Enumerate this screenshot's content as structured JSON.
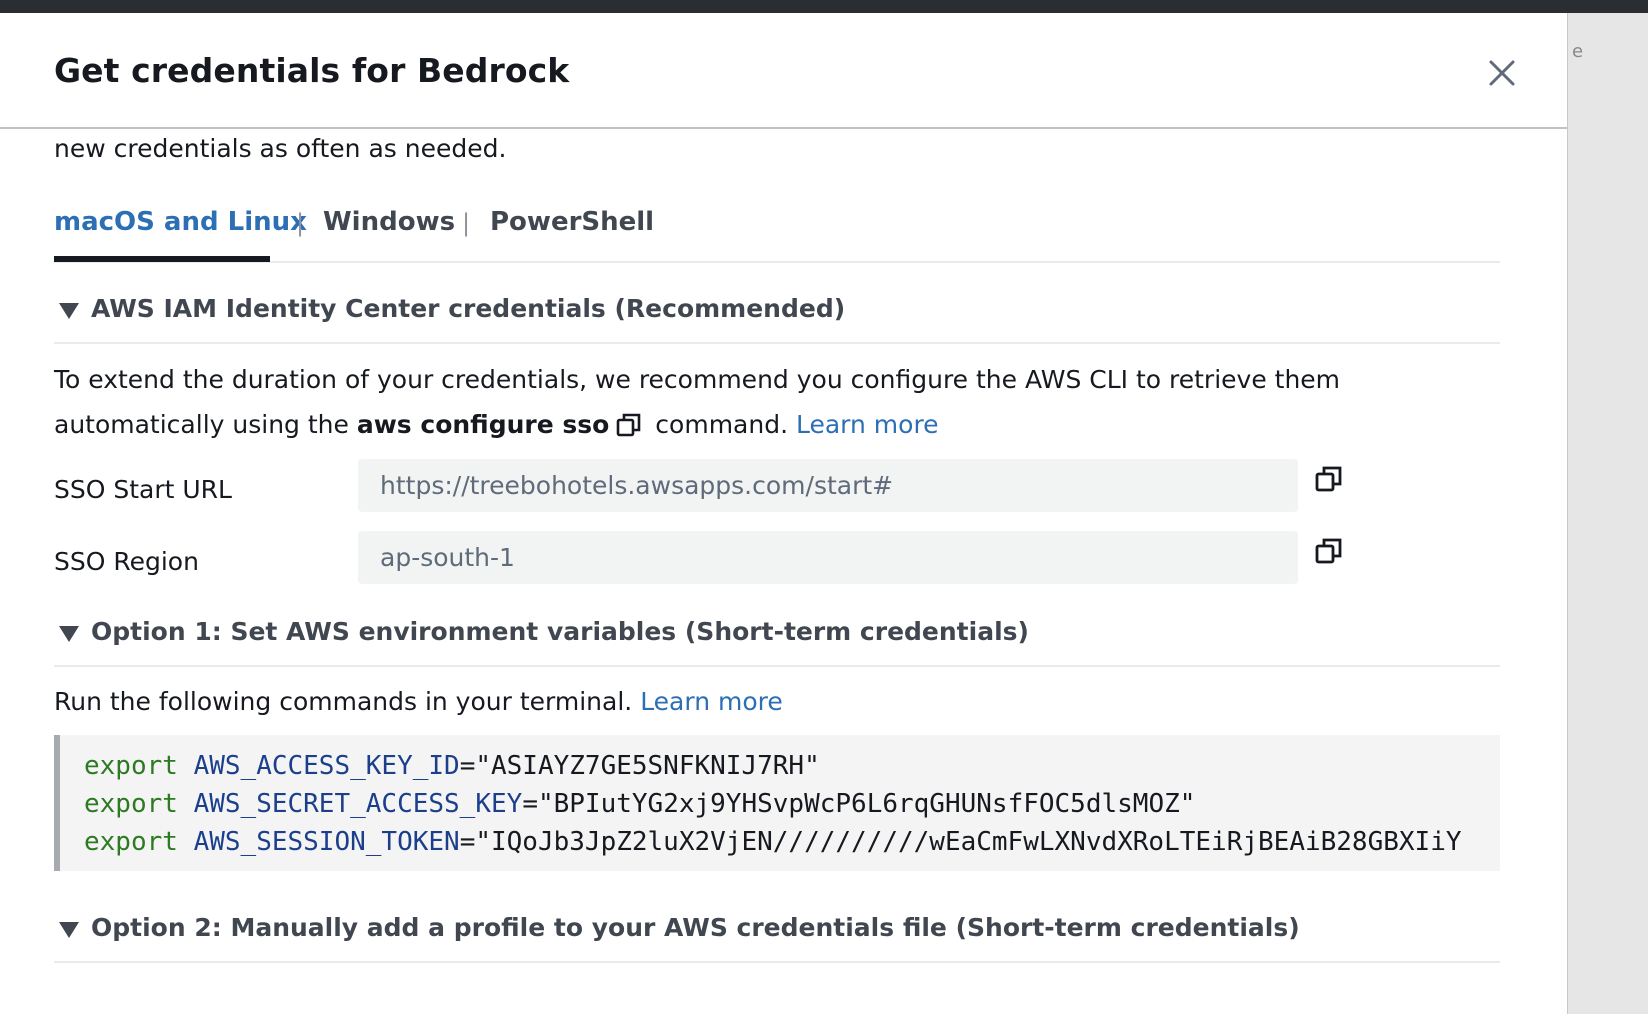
{
  "modal": {
    "title": "Get credentials for Bedrock",
    "intro_tail": "new credentials as often as needed."
  },
  "backdrop": {
    "ghost_text": "e"
  },
  "tabs": [
    {
      "label": "macOS and Linux",
      "active": true
    },
    {
      "label": "Windows",
      "active": false
    },
    {
      "label": "PowerShell",
      "active": false
    }
  ],
  "tab_separator": "|",
  "identity_center": {
    "heading": "AWS IAM Identity Center credentials (Recommended)",
    "desc_line1": "To extend the duration of your credentials, we recommend you configure the AWS CLI to retrieve them",
    "desc_line2_prefix": "automatically using the",
    "desc_command": "aws configure sso",
    "desc_line2_suffix": "command.",
    "learn_more": "Learn more",
    "fields": [
      {
        "label": "SSO Start URL",
        "value": "https://treebohotels.awsapps.com/start#"
      },
      {
        "label": "SSO Region",
        "value": "ap-south-1"
      }
    ]
  },
  "option1": {
    "heading": "Option 1: Set AWS environment variables (Short-term credentials)",
    "desc": "Run the following commands in your terminal.",
    "learn_more": "Learn more",
    "commands": [
      {
        "keyword": "export",
        "name": "AWS_ACCESS_KEY_ID",
        "value": "\"ASIAYZ7GE5SNFKNIJ7RH\""
      },
      {
        "keyword": "export",
        "name": "AWS_SECRET_ACCESS_KEY",
        "value": "\"BPIutYG2xj9YHSvpWcP6L6rqGHUNsfFOC5dlsMOZ\""
      },
      {
        "keyword": "export",
        "name": "AWS_SESSION_TOKEN",
        "value": "\"IQoJb3JpZ2luX2VjEN//////////wEaCmFwLXNvdXRoLTEiRjBEAiB28GBXIiY"
      }
    ]
  },
  "option2": {
    "heading": "Option 2: Manually add a profile to your AWS credentials file (Short-term credentials)"
  },
  "colors": {
    "link": "#2c6fb4",
    "keyword": "#2d7a23",
    "variable": "#1c3f8c",
    "heading": "#414750",
    "text": "#16191f"
  },
  "icons": {
    "close": "close-icon",
    "caret": "caret-down-icon",
    "copy": "copy-icon"
  }
}
